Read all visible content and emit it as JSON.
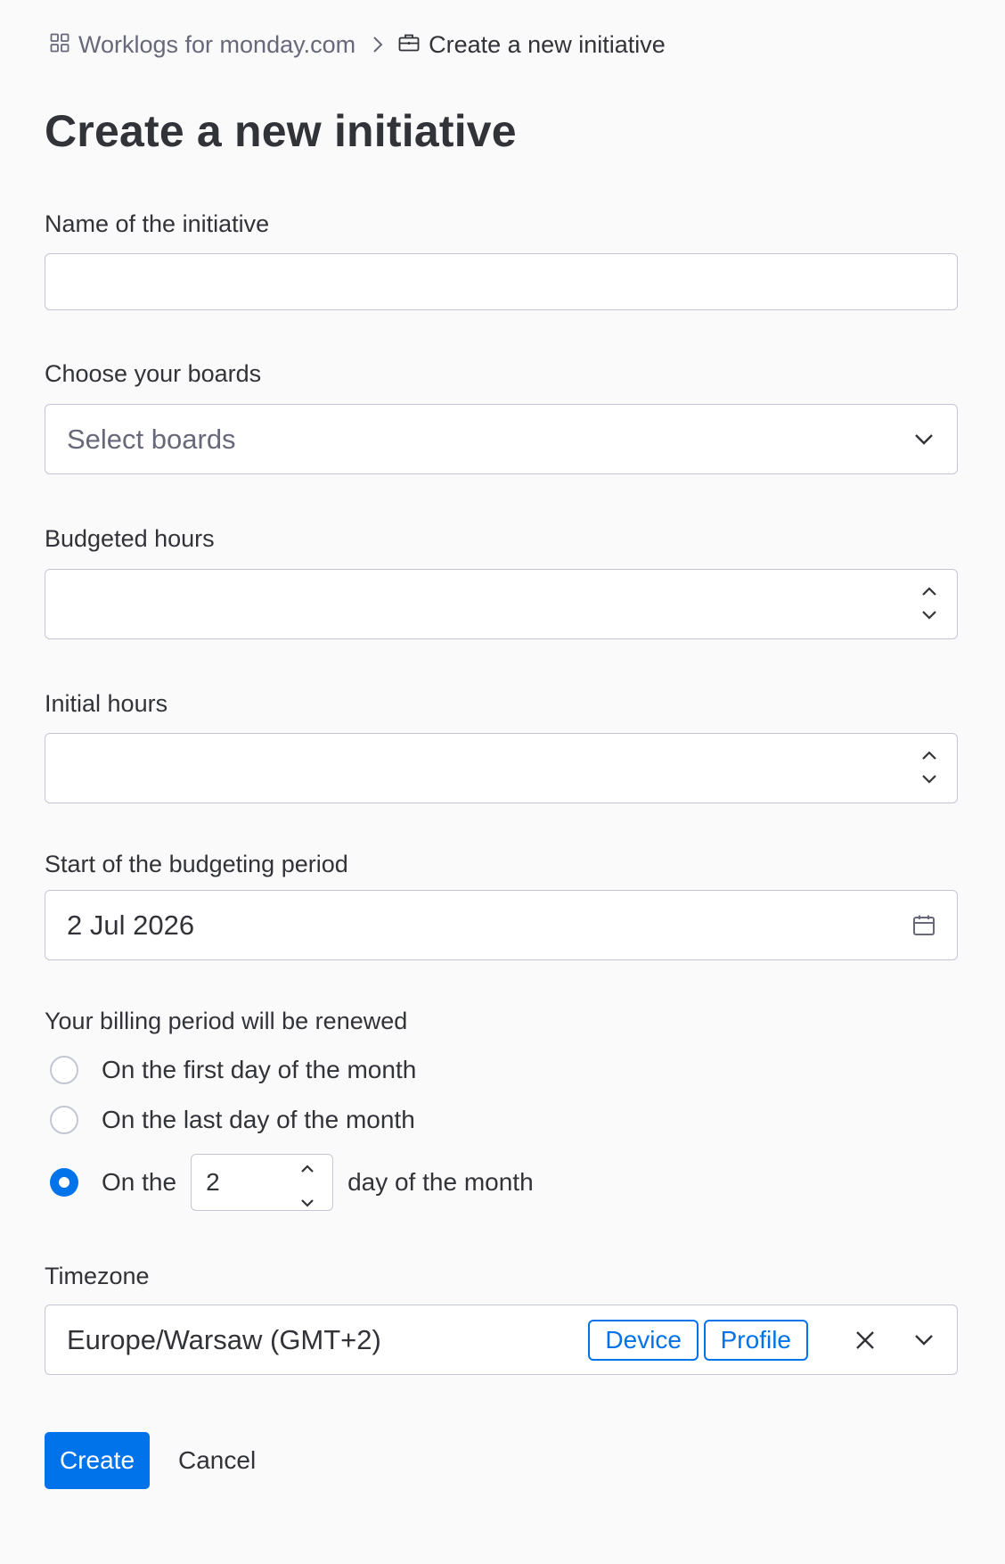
{
  "breadcrumb": {
    "root_label": "Worklogs for monday.com",
    "current_label": "Create a new initiative"
  },
  "page": {
    "title": "Create a new initiative"
  },
  "form": {
    "name": {
      "label": "Name of the initiative",
      "value": ""
    },
    "boards": {
      "label": "Choose your boards",
      "placeholder": "Select boards"
    },
    "budgeted_hours": {
      "label": "Budgeted hours",
      "value": ""
    },
    "initial_hours": {
      "label": "Initial hours",
      "value": ""
    },
    "start_date": {
      "label": "Start of the budgeting period",
      "value": "2 Jul 2026"
    },
    "billing": {
      "label": "Your billing period will be renewed",
      "options": [
        {
          "label": "On the first day of the month",
          "checked": false
        },
        {
          "label": "On the last day of the month",
          "checked": false
        },
        {
          "prefix": "On the",
          "day_value": "2",
          "suffix": "day of the month",
          "checked": true
        }
      ]
    },
    "timezone": {
      "label": "Timezone",
      "value": "Europe/Warsaw (GMT+2)",
      "chip_device": "Device",
      "chip_profile": "Profile"
    }
  },
  "actions": {
    "create_label": "Create",
    "cancel_label": "Cancel"
  },
  "colors": {
    "primary": "#0073ea",
    "text": "#323338",
    "muted": "#676879",
    "border": "#c3c6d4",
    "background": "#fafafb"
  }
}
